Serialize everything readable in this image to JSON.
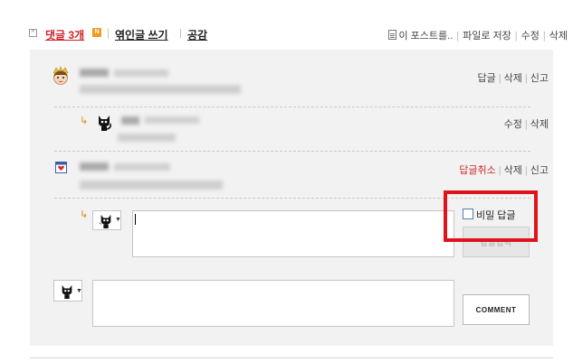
{
  "header": {
    "collapse_glyph": "^",
    "reply_count_label": "댓글 3개",
    "new_badge": "N",
    "trackback_label": "엮인글 쓰기",
    "sympathy_label": "공감",
    "separator": "|",
    "post_title_label": "이 포스트를..",
    "save_file_label": "파일로 저장",
    "edit_label": "수정",
    "delete_label": "삭제"
  },
  "comments": [
    {
      "actions": [
        "답글",
        "삭제",
        "신고"
      ]
    },
    {
      "is_reply": true,
      "actions": [
        "수정",
        "삭제"
      ]
    },
    {
      "actions": [
        "답글취소",
        "삭제",
        "신고"
      ],
      "active_action": "답글취소"
    }
  ],
  "reply_form": {
    "arrow": "↳",
    "secret_label": "비밀 답글",
    "secret_checked": false,
    "submit_label": "답글입력"
  },
  "comment_form": {
    "submit_label": "COMMENT"
  },
  "colors": {
    "accent_red": "#d0232a",
    "highlight_box": "#e0131b",
    "reply_arrow": "#e08a1a",
    "panel_bg": "#f2f2f2"
  }
}
